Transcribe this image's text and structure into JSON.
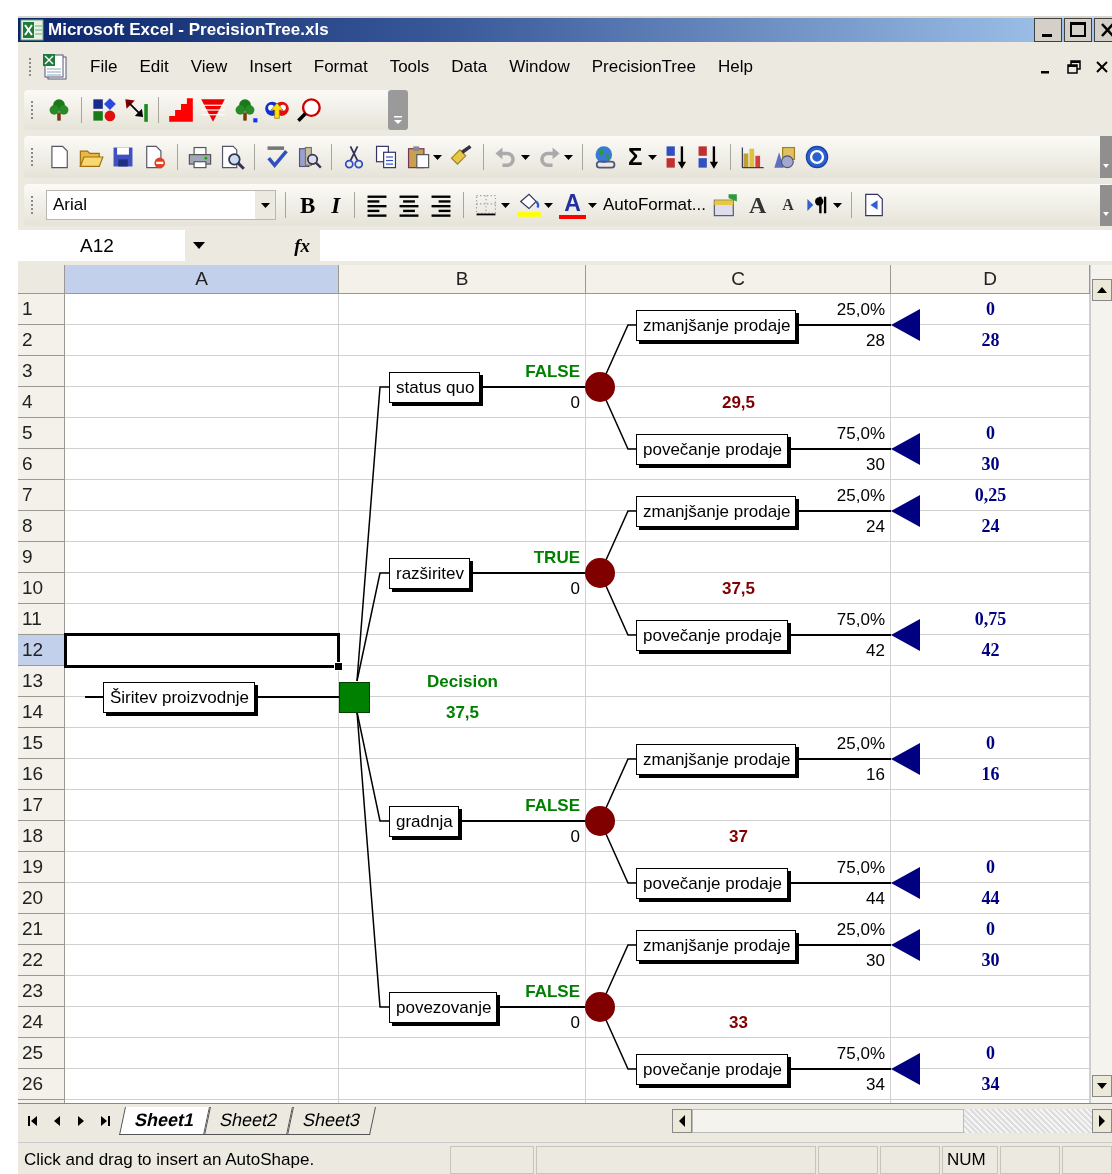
{
  "window": {
    "title": "Microsoft Excel - PrecisionTree.xls"
  },
  "menu": [
    {
      "label": "File"
    },
    {
      "label": "Edit"
    },
    {
      "label": "View"
    },
    {
      "label": "Insert"
    },
    {
      "label": "Format"
    },
    {
      "label": "Tools"
    },
    {
      "label": "Data"
    },
    {
      "label": "Window"
    },
    {
      "label": "PrecisionTree"
    },
    {
      "label": "Help"
    }
  ],
  "standard_toolbar": {
    "autosum": "Σ"
  },
  "formatting_toolbar": {
    "font": "Arial",
    "bold": "B",
    "italic": "I",
    "font_color": "A",
    "autoformat": "AutoFormat...",
    "grow_font": "A",
    "shrink_font": "A"
  },
  "formula_bar": {
    "name_box": "A12",
    "function_label": "fx"
  },
  "columns": [
    {
      "label": "A",
      "selected": true
    },
    {
      "label": "B",
      "selected": false
    },
    {
      "label": "C",
      "selected": false
    },
    {
      "label": "D",
      "selected": false
    }
  ],
  "rows": [
    {
      "label": "1",
      "selected": false
    },
    {
      "label": "2",
      "selected": false
    },
    {
      "label": "3",
      "selected": false
    },
    {
      "label": "4",
      "selected": false
    },
    {
      "label": "5",
      "selected": false
    },
    {
      "label": "6",
      "selected": false
    },
    {
      "label": "7",
      "selected": false
    },
    {
      "label": "8",
      "selected": false
    },
    {
      "label": "9",
      "selected": false
    },
    {
      "label": "10",
      "selected": false
    },
    {
      "label": "11",
      "selected": false
    },
    {
      "label": "12",
      "selected": true
    },
    {
      "label": "13",
      "selected": false
    },
    {
      "label": "14",
      "selected": false
    },
    {
      "label": "15",
      "selected": false
    },
    {
      "label": "16",
      "selected": false
    },
    {
      "label": "17",
      "selected": false
    },
    {
      "label": "18",
      "selected": false
    },
    {
      "label": "19",
      "selected": false
    },
    {
      "label": "20",
      "selected": false
    },
    {
      "label": "21",
      "selected": false
    },
    {
      "label": "22",
      "selected": false
    },
    {
      "label": "23",
      "selected": false
    },
    {
      "label": "24",
      "selected": false
    },
    {
      "label": "25",
      "selected": false
    },
    {
      "label": "26",
      "selected": false
    }
  ],
  "tree": {
    "root": {
      "label": "Širitev proizvodnje"
    },
    "decision": {
      "name": "Decision",
      "value": "37,5"
    },
    "branches": [
      {
        "label": "status quo",
        "choice": "FALSE",
        "value": "0",
        "chance": {
          "value": "29,5",
          "outcomes": [
            {
              "label": "zmanjšanje prodaje",
              "probability": "25,0%",
              "value": "28",
              "end_probability": "0",
              "end_value": "28"
            },
            {
              "label": "povečanje prodaje",
              "probability": "75,0%",
              "value": "30",
              "end_probability": "0",
              "end_value": "30"
            }
          ]
        }
      },
      {
        "label": "razširitev",
        "choice": "TRUE",
        "value": "0",
        "chance": {
          "value": "37,5",
          "outcomes": [
            {
              "label": "zmanjšanje prodaje",
              "probability": "25,0%",
              "value": "24",
              "end_probability": "0,25",
              "end_value": "24"
            },
            {
              "label": "povečanje prodaje",
              "probability": "75,0%",
              "value": "42",
              "end_probability": "0,75",
              "end_value": "42"
            }
          ]
        }
      },
      {
        "label": "gradnja",
        "choice": "FALSE",
        "value": "0",
        "chance": {
          "value": "37",
          "outcomes": [
            {
              "label": "zmanjšanje prodaje",
              "probability": "25,0%",
              "value": "16",
              "end_probability": "0",
              "end_value": "16"
            },
            {
              "label": "povečanje prodaje",
              "probability": "75,0%",
              "value": "44",
              "end_probability": "0",
              "end_value": "44"
            }
          ]
        }
      },
      {
        "label": "povezovanje",
        "choice": "FALSE",
        "value": "0",
        "chance": {
          "value": "33",
          "outcomes": [
            {
              "label": "zmanjšanje prodaje",
              "probability": "25,0%",
              "value": "30",
              "end_probability": "0",
              "end_value": "30"
            },
            {
              "label": "povečanje prodaje",
              "probability": "75,0%",
              "value": "34",
              "end_probability": "0",
              "end_value": "34"
            }
          ]
        }
      }
    ]
  },
  "sheet_tabs": [
    {
      "label": "Sheet1",
      "selected": true
    },
    {
      "label": "Sheet2",
      "selected": false
    },
    {
      "label": "Sheet3",
      "selected": false
    }
  ],
  "status_bar": {
    "message": "Click and drag to insert an AutoShape.",
    "indicator": "NUM"
  }
}
